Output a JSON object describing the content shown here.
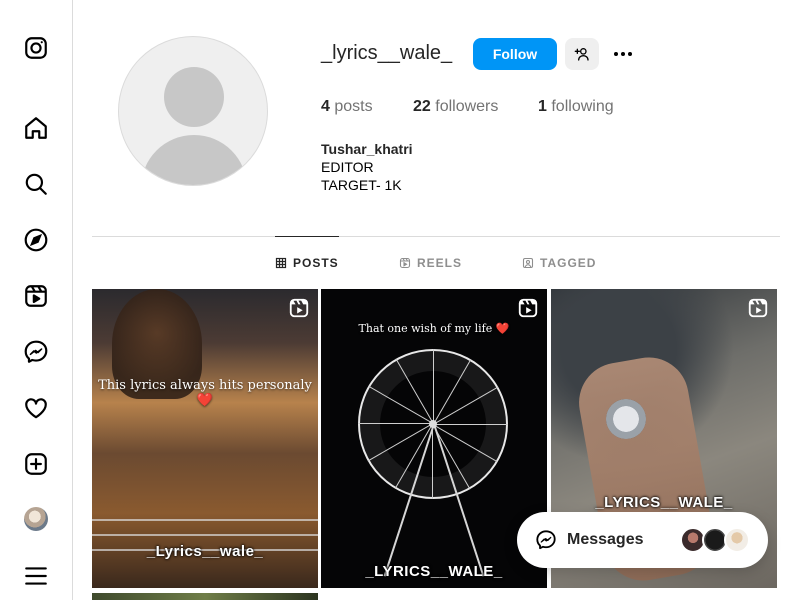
{
  "sidebar": {
    "items": [
      {
        "name": "instagram-logo-icon"
      },
      {
        "name": "home-icon"
      },
      {
        "name": "search-icon"
      },
      {
        "name": "explore-icon"
      },
      {
        "name": "reels-icon"
      },
      {
        "name": "messenger-icon"
      },
      {
        "name": "heart-icon"
      },
      {
        "name": "create-icon"
      },
      {
        "name": "profile-avatar"
      },
      {
        "name": "menu-icon"
      }
    ]
  },
  "profile": {
    "username": "_lyrics__wale_",
    "follow_label": "Follow",
    "posts_count": "4",
    "posts_label": "posts",
    "followers_count": "22",
    "followers_label": "followers",
    "following_count": "1",
    "following_label": "following",
    "full_name": "Tushar_khatri",
    "bio_line1": "EDITOR",
    "bio_line2": "TARGET- 1K"
  },
  "tabs": [
    {
      "label": "POSTS",
      "active": true
    },
    {
      "label": "REELS",
      "active": false
    },
    {
      "label": "TAGGED",
      "active": false
    }
  ],
  "posts": [
    {
      "caption": "This lyrics always hits personaly ❤️",
      "watermark": "_Lyrics__wale_"
    },
    {
      "caption": "That one wish of my life ❤️",
      "watermark": "_LYRICS__WALE_"
    },
    {
      "caption": "",
      "watermark": "_LYRICS__WALE_"
    }
  ],
  "messages": {
    "label": "Messages"
  },
  "colors": {
    "accent": "#0095f6",
    "border": "#dbdbdb",
    "text": "#262626",
    "muted": "#737373"
  }
}
